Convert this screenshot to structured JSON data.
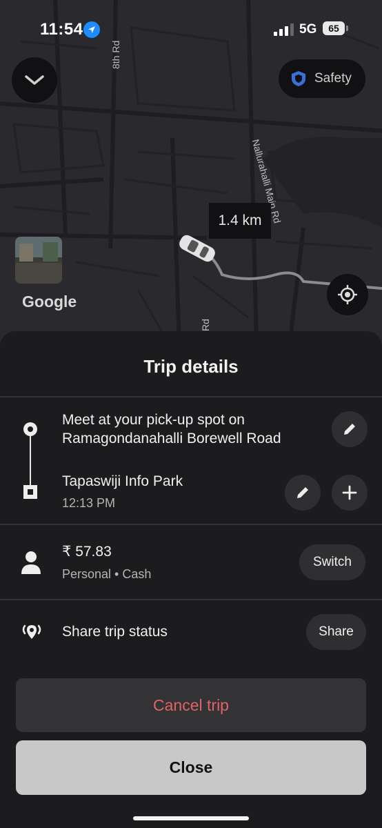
{
  "status_bar": {
    "time": "11:54",
    "network": "5G",
    "battery": "65"
  },
  "map": {
    "roads": [
      "8th Rd",
      "Nallurahalli Main Rd",
      "Rd"
    ],
    "distance": "1.4 km",
    "safety_label": "Safety",
    "attribution": "Google",
    "icons": [
      "chevron-down-icon",
      "shield-icon",
      "car-icon",
      "crosshair-icon"
    ]
  },
  "trip": {
    "title": "Trip details",
    "pickup": {
      "line1": "Meet at your pick-up spot on",
      "line2": "Ramagondanahalli Borewell Road"
    },
    "dropoff": {
      "name": "Tapaswiji Info Park",
      "eta": "12:13 PM"
    },
    "fare": {
      "amount": "₹ 57.83",
      "method": "Personal • Cash",
      "switch_label": "Switch"
    },
    "share": {
      "label": "Share trip status",
      "button": "Share"
    },
    "cancel_label": "Cancel trip",
    "close_label": "Close"
  },
  "colors": {
    "accent_red": "#e06464",
    "map_bg": "#2a2a2e",
    "sheet_bg": "#1c1c1e",
    "location_blue": "#1e8bff",
    "shield_blue": "#3a6fd8"
  }
}
